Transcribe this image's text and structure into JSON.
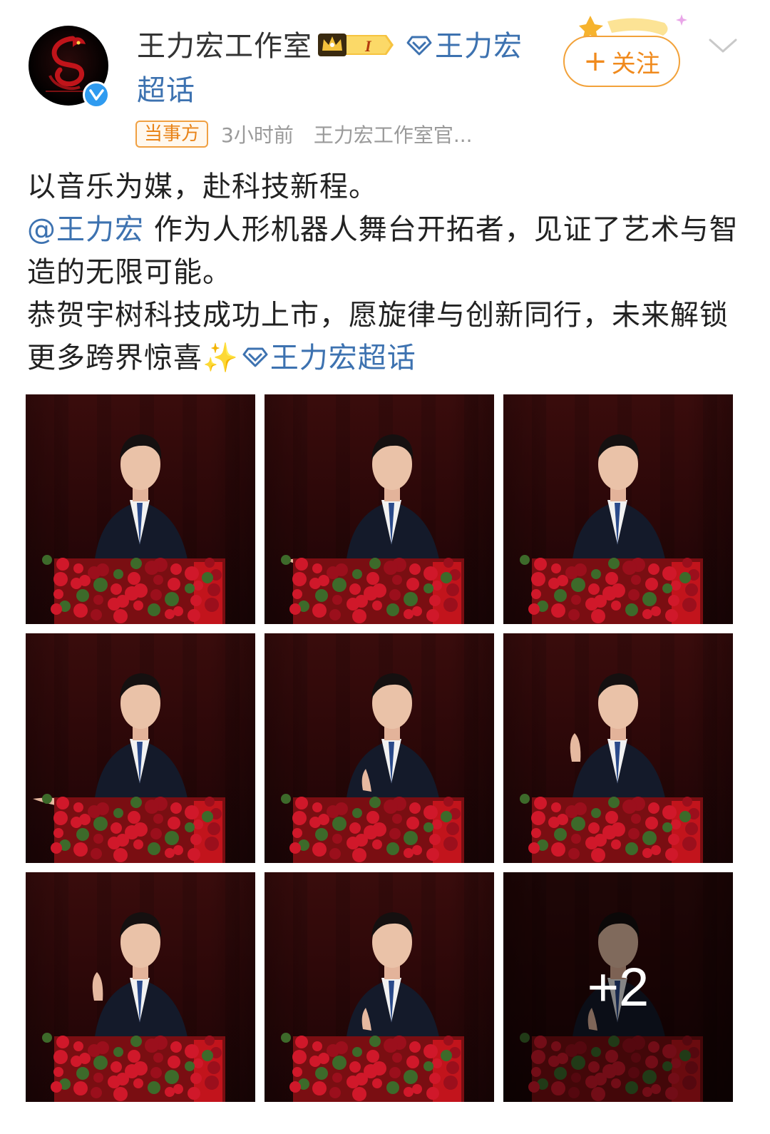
{
  "header": {
    "account_name": "王力宏工作室",
    "level_badge": "I",
    "supertopic": "王力宏超话",
    "follow_label": "关注",
    "follow_plus": "+",
    "party_badge": "当事方",
    "time": "3小时前",
    "source": "王力宏工作室官..."
  },
  "post": {
    "line1": "以音乐为媒，赴科技新程。",
    "mention": "@王力宏",
    "line2_rest": " 作为人形机器人舞台开拓者，见证了艺术与智造的无限可能。",
    "line3": "恭贺宇树科技成功上市，愿旋律与创新同行，未来解锁更多跨界惊喜",
    "sparkle": "✨",
    "topic": "王力宏超话"
  },
  "gallery": {
    "photo_count_visible": 9,
    "more_label": "+2"
  },
  "colors": {
    "link": "#3d72b0",
    "accent": "#f08a1d",
    "verified": "#2f9bf0"
  }
}
